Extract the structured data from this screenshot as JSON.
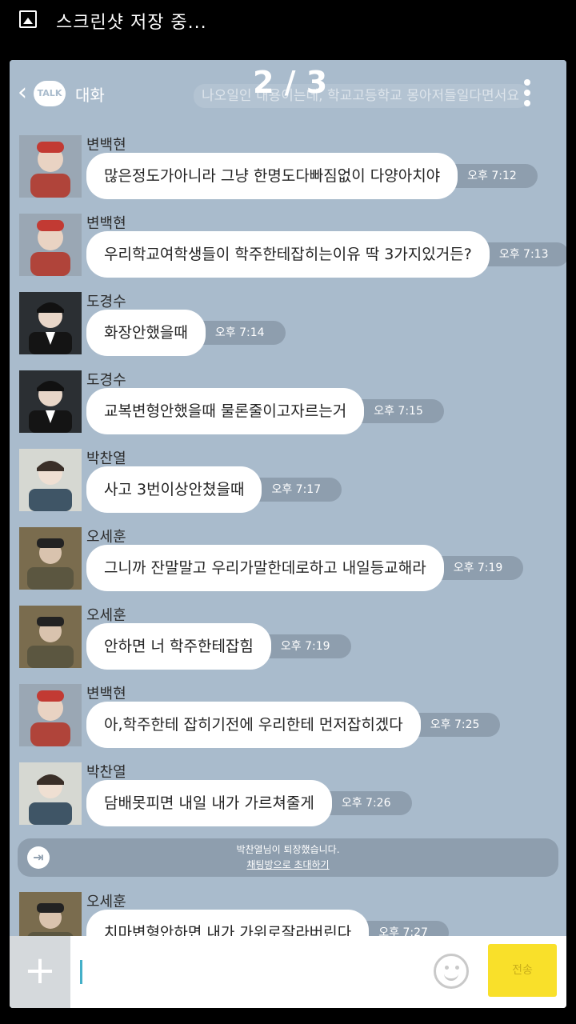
{
  "status_bar": {
    "text": "스크린샷 저장 중..."
  },
  "header": {
    "logo_text": "TALK",
    "title": "대화",
    "page_count": "2 / 3",
    "faded_text": "나오일인 내용이는데, 학교고등학교 몽아저들일다면서요"
  },
  "messages": [
    {
      "sender": "변백현",
      "text": "많은정도가아니라 그냥 한명도다빠짐없이 다양아치야",
      "time": "오후 7:12",
      "avatar_color": "#b0443a"
    },
    {
      "sender": "변백현",
      "text": "우리학교여학생들이 학주한테잡히는이유 딱 3가지있거든?",
      "time": "오후 7:13",
      "avatar_color": "#b0443a"
    },
    {
      "sender": "도경수",
      "text": "화장안했을때",
      "time": "오후 7:14",
      "avatar_color": "#2a2a2a"
    },
    {
      "sender": "도경수",
      "text": "교복변형안했을때 물론줄이고자르는거",
      "time": "오후 7:15",
      "avatar_color": "#2a2a2a"
    },
    {
      "sender": "박찬열",
      "text": "사고 3번이상안쳤을때",
      "time": "오후 7:17",
      "avatar_color": "#3f5566"
    },
    {
      "sender": "오세훈",
      "text": "그니까 잔말말고 우리가말한데로하고 내일등교해라",
      "time": "오후 7:19",
      "avatar_color": "#5b5640"
    },
    {
      "sender": "오세훈",
      "text": "안하면 너 학주한테잡힘",
      "time": "오후 7:19",
      "avatar_color": "#5b5640"
    },
    {
      "sender": "변백현",
      "text": "아,학주한테 잡히기전에 우리한테 먼저잡히겠다",
      "time": "오후 7:25",
      "avatar_color": "#b0443a"
    },
    {
      "sender": "박찬열",
      "text": "담배못피면 내일 내가 가르쳐줄게",
      "time": "오후 7:26",
      "avatar_color": "#3f5566"
    }
  ],
  "notice": {
    "line1": "박찬열님이 퇴장했습니다.",
    "line2": "채팅방으로 초대하기"
  },
  "last_message": {
    "sender": "오세훈",
    "text": "치마변형안하면 내가 가위로잘라버린다",
    "time": "오후 7:27",
    "avatar_color": "#5b5640"
  },
  "input": {
    "send_label": "전송"
  }
}
